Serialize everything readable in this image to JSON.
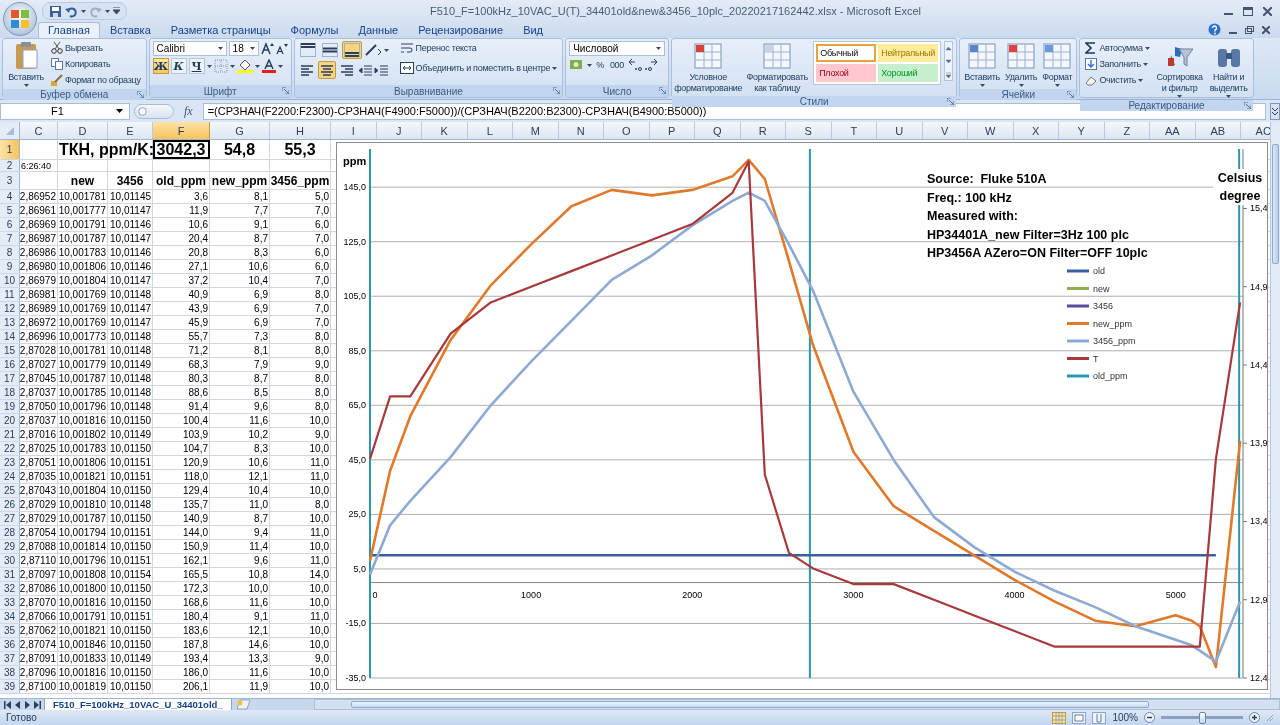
{
  "window": {
    "title": "F510_F=100kHz_10VAC_U(T)_34401old&new&3456_10plc_20220217162442.xlsx - Microsoft Excel"
  },
  "ribbon": {
    "tabs": [
      {
        "label": "Главная",
        "selected": true
      },
      {
        "label": "Вставка",
        "selected": false
      },
      {
        "label": "Разметка страницы",
        "selected": false
      },
      {
        "label": "Формулы",
        "selected": false
      },
      {
        "label": "Данные",
        "selected": false
      },
      {
        "label": "Рецензирование",
        "selected": false
      },
      {
        "label": "Вид",
        "selected": false
      }
    ],
    "groups": [
      {
        "kind": "clipboard",
        "label": "Буфер обмена",
        "paste": "Вставить",
        "items": [
          "Вырезать",
          "Копировать",
          "Формат по образцу"
        ]
      },
      {
        "kind": "font",
        "label": "Шрифт",
        "font": "Calibri",
        "size": "18",
        "styles": [
          {
            "label": "Ж",
            "on": true
          },
          {
            "label": "К",
            "on": false
          },
          {
            "label": "Ч",
            "on": false
          }
        ]
      },
      {
        "kind": "alignment",
        "label": "Выравнивание",
        "vertical": [
          {
            "on": false
          },
          {
            "on": false
          },
          {
            "on": true
          }
        ],
        "horizontal": [
          {
            "on": false
          },
          {
            "on": true
          },
          {
            "on": false
          }
        ],
        "wrap": "Перенос текста",
        "merge": "Объединить и поместить в центре"
      },
      {
        "kind": "number",
        "label": "Число",
        "format": "Числовой",
        "percent": "%",
        "thousands": "000"
      },
      {
        "kind": "styles",
        "label": "Стили",
        "buttons": [
          "Условное форматирование",
          "Форматировать как таблицу"
        ],
        "cell_styles": [
          {
            "label": "Обычный",
            "color": "#ffffff",
            "selected": true
          },
          {
            "label": "Нейтральный",
            "color": "#ffeb9c",
            "selected": false
          },
          {
            "label": "Плохой",
            "color": "#ffc7ce",
            "selected": false
          },
          {
            "label": "Хороший",
            "color": "#c6efce",
            "selected": false
          }
        ]
      },
      {
        "kind": "cells",
        "label": "Ячейки",
        "buttons": [
          "Вставить",
          "Удалить",
          "Формат"
        ]
      },
      {
        "kind": "editing",
        "label": "Редактирование",
        "items": [
          "Автосумма",
          "Заполнить",
          "Очистить"
        ],
        "buttons": [
          "Сортировка и фильтр",
          "Найти и выделить"
        ]
      }
    ]
  },
  "formula_bar": {
    "name_box": "F1",
    "fx": "fx",
    "formula": "=(СРЗНАЧ(F2200:F2300)-СРЗНАЧ(F4900:F5000))/(СРЗНАЧ(B2200:B2300)-СРЗНАЧ(B4900:B5000))"
  },
  "sheet": {
    "columns": [
      {
        "label": "C",
        "selected": false
      },
      {
        "label": "D",
        "selected": false
      },
      {
        "label": "E",
        "selected": false
      },
      {
        "label": "F",
        "selected": true
      },
      {
        "label": "G",
        "selected": false
      },
      {
        "label": "H",
        "selected": false
      },
      {
        "label": "I",
        "selected": false
      },
      {
        "label": "J",
        "selected": false
      },
      {
        "label": "K",
        "selected": false
      },
      {
        "label": "L",
        "selected": false
      },
      {
        "label": "M",
        "selected": false
      },
      {
        "label": "N",
        "selected": false
      },
      {
        "label": "O",
        "selected": false
      },
      {
        "label": "P",
        "selected": false
      },
      {
        "label": "Q",
        "selected": false
      },
      {
        "label": "R",
        "selected": false
      },
      {
        "label": "S",
        "selected": false
      },
      {
        "label": "T",
        "selected": false
      },
      {
        "label": "U",
        "selected": false
      },
      {
        "label": "V",
        "selected": false
      },
      {
        "label": "W",
        "selected": false
      },
      {
        "label": "X",
        "selected": false
      },
      {
        "label": "Y",
        "selected": false
      },
      {
        "label": "Z",
        "selected": false
      },
      {
        "label": "AA",
        "selected": false
      },
      {
        "label": "AB",
        "selected": false
      },
      {
        "label": "AC",
        "selected": false
      }
    ],
    "rows": [
      {
        "row": "1",
        "kind": "title",
        "selected": true,
        "cells": [
          null,
          "ТКН, ppm/K:",
          null,
          "3042,3",
          "54,8",
          "55,3"
        ]
      },
      {
        "row": "2",
        "kind": "time",
        "selected": false,
        "cells": [
          "6:26:40",
          null,
          null,
          null,
          null,
          null
        ]
      },
      {
        "row": "3",
        "kind": "header",
        "selected": false,
        "cells": [
          null,
          "new",
          "3456",
          "old_ppm",
          "new_ppm",
          "3456_ppm"
        ]
      },
      {
        "row": "4",
        "kind": "data",
        "selected": false,
        "cells": [
          "2,86952",
          "10,001781",
          "10,01145",
          "3,6",
          "8,1",
          "5,0"
        ]
      },
      {
        "row": "5",
        "kind": "data",
        "selected": false,
        "cells": [
          "2,86961",
          "10,001777",
          "10,01147",
          "11,9",
          "7,7",
          "7,0"
        ]
      },
      {
        "row": "6",
        "kind": "data",
        "selected": false,
        "cells": [
          "2,86969",
          "10,001791",
          "10,01146",
          "10,6",
          "9,1",
          "6,0"
        ]
      },
      {
        "row": "7",
        "kind": "data",
        "selected": false,
        "cells": [
          "2,86987",
          "10,001787",
          "10,01147",
          "20,4",
          "8,7",
          "7,0"
        ]
      },
      {
        "row": "8",
        "kind": "data",
        "selected": false,
        "cells": [
          "2,86986",
          "10,001783",
          "10,01146",
          "20,8",
          "8,3",
          "6,0"
        ]
      },
      {
        "row": "9",
        "kind": "data",
        "selected": false,
        "cells": [
          "2,86980",
          "10,001806",
          "10,01146",
          "27,1",
          "10,6",
          "6,0"
        ]
      },
      {
        "row": "10",
        "kind": "data",
        "selected": false,
        "cells": [
          "2,86979",
          "10,001804",
          "10,01147",
          "37,2",
          "10,4",
          "7,0"
        ]
      },
      {
        "row": "11",
        "kind": "data",
        "selected": false,
        "cells": [
          "2,86981",
          "10,001769",
          "10,01148",
          "40,9",
          "6,9",
          "8,0"
        ]
      },
      {
        "row": "12",
        "kind": "data",
        "selected": false,
        "cells": [
          "2,86989",
          "10,001769",
          "10,01147",
          "43,9",
          "6,9",
          "7,0"
        ]
      },
      {
        "row": "13",
        "kind": "data",
        "selected": false,
        "cells": [
          "2,86972",
          "10,001769",
          "10,01147",
          "45,9",
          "6,9",
          "7,0"
        ]
      },
      {
        "row": "14",
        "kind": "data",
        "selected": false,
        "cells": [
          "2,86996",
          "10,001773",
          "10,01148",
          "55,7",
          "7,3",
          "8,0"
        ]
      },
      {
        "row": "15",
        "kind": "data",
        "selected": false,
        "cells": [
          "2,87028",
          "10,001781",
          "10,01148",
          "71,2",
          "8,1",
          "8,0"
        ]
      },
      {
        "row": "16",
        "kind": "data",
        "selected": false,
        "cells": [
          "2,87027",
          "10,001779",
          "10,01149",
          "68,3",
          "7,9",
          "9,0"
        ]
      },
      {
        "row": "17",
        "kind": "data",
        "selected": false,
        "cells": [
          "2,87045",
          "10,001787",
          "10,01148",
          "80,3",
          "8,7",
          "8,0"
        ]
      },
      {
        "row": "18",
        "kind": "data",
        "selected": false,
        "cells": [
          "2,87037",
          "10,001785",
          "10,01148",
          "88,6",
          "8,5",
          "8,0"
        ]
      },
      {
        "row": "19",
        "kind": "data",
        "selected": false,
        "cells": [
          "2,87050",
          "10,001796",
          "10,01148",
          "91,4",
          "9,6",
          "8,0"
        ]
      },
      {
        "row": "20",
        "kind": "data",
        "selected": false,
        "cells": [
          "2,87037",
          "10,001816",
          "10,01150",
          "100,4",
          "11,6",
          "10,0"
        ]
      },
      {
        "row": "21",
        "kind": "data",
        "selected": false,
        "cells": [
          "2,87016",
          "10,001802",
          "10,01149",
          "103,9",
          "10,2",
          "9,0"
        ]
      },
      {
        "row": "22",
        "kind": "data",
        "selected": false,
        "cells": [
          "2,87025",
          "10,001783",
          "10,01150",
          "104,7",
          "8,3",
          "10,0"
        ]
      },
      {
        "row": "23",
        "kind": "data",
        "selected": false,
        "cells": [
          "2,87051",
          "10,001806",
          "10,01151",
          "120,9",
          "10,6",
          "11,0"
        ]
      },
      {
        "row": "24",
        "kind": "data",
        "selected": false,
        "cells": [
          "2,87035",
          "10,001821",
          "10,01151",
          "118,0",
          "12,1",
          "11,0"
        ]
      },
      {
        "row": "25",
        "kind": "data",
        "selected": false,
        "cells": [
          "2,87043",
          "10,001804",
          "10,01150",
          "129,4",
          "10,4",
          "10,0"
        ]
      },
      {
        "row": "26",
        "kind": "data",
        "selected": false,
        "cells": [
          "2,87029",
          "10,001810",
          "10,01148",
          "135,7",
          "11,0",
          "8,0"
        ]
      },
      {
        "row": "27",
        "kind": "data",
        "selected": false,
        "cells": [
          "2,87029",
          "10,001787",
          "10,01150",
          "140,9",
          "8,7",
          "10,0"
        ]
      },
      {
        "row": "28",
        "kind": "data",
        "selected": false,
        "cells": [
          "2,87054",
          "10,001794",
          "10,01151",
          "144,0",
          "9,4",
          "11,0"
        ]
      },
      {
        "row": "29",
        "kind": "data",
        "selected": false,
        "cells": [
          "2,87088",
          "10,001814",
          "10,01150",
          "150,9",
          "11,4",
          "10,0"
        ]
      },
      {
        "row": "30",
        "kind": "data",
        "selected": false,
        "cells": [
          "2,87110",
          "10,001796",
          "10,01151",
          "162,1",
          "9,6",
          "11,0"
        ]
      },
      {
        "row": "31",
        "kind": "data",
        "selected": false,
        "cells": [
          "2,87097",
          "10,001808",
          "10,01154",
          "165,5",
          "10,8",
          "14,0"
        ]
      },
      {
        "row": "32",
        "kind": "data",
        "selected": false,
        "cells": [
          "2,87086",
          "10,001800",
          "10,01150",
          "172,3",
          "10,0",
          "10,0"
        ]
      },
      {
        "row": "33",
        "kind": "data",
        "selected": false,
        "cells": [
          "2,87070",
          "10,001816",
          "10,01150",
          "168,6",
          "11,6",
          "10,0"
        ]
      },
      {
        "row": "34",
        "kind": "data",
        "selected": false,
        "cells": [
          "2,87066",
          "10,001791",
          "10,01151",
          "180,4",
          "9,1",
          "11,0"
        ]
      },
      {
        "row": "35",
        "kind": "data",
        "selected": false,
        "cells": [
          "2,87062",
          "10,001821",
          "10,01150",
          "183,6",
          "12,1",
          "10,0"
        ]
      },
      {
        "row": "36",
        "kind": "data",
        "selected": false,
        "cells": [
          "2,87074",
          "10,001846",
          "10,01150",
          "187,8",
          "14,6",
          "10,0"
        ]
      },
      {
        "row": "37",
        "kind": "data",
        "selected": false,
        "cells": [
          "2,87091",
          "10,001833",
          "10,01149",
          "193,4",
          "13,3",
          "9,0"
        ]
      },
      {
        "row": "38",
        "kind": "data",
        "selected": false,
        "cells": [
          "2,87096",
          "10,001816",
          "10,01150",
          "186,0",
          "11,6",
          "10,0"
        ]
      },
      {
        "row": "39",
        "kind": "data",
        "selected": false,
        "cells": [
          "2,87100",
          "10,001819",
          "10,01150",
          "206,1",
          "11,9",
          "10,0"
        ]
      }
    ]
  },
  "chart": {
    "text_box": [
      "Source:  Fluke 510A",
      "Freq.: 100 kHz",
      "Measured with:",
      "HP34401A_new Filter=3Hz 100 plc",
      "HP3456A AZero=ON Filter=OFF 10plc"
    ],
    "chart_data": {
      "type": "line",
      "ylabel": "ppm",
      "y2label": "Celsius degree",
      "x": [
        0,
        125,
        250,
        500,
        750,
        1000,
        1250,
        1500,
        1750,
        2000,
        2250,
        2350,
        2450,
        2600,
        2750,
        3000,
        3250,
        3500,
        3750,
        4000,
        4250,
        4500,
        4750,
        5000,
        5100,
        5150,
        5250,
        5400
      ],
      "grid": true,
      "legend": "right",
      "xlim": [
        0,
        5418
      ],
      "ylim": [
        -35,
        159
      ],
      "y2lim": [
        12.4,
        15.78
      ],
      "xticks": [
        0,
        1000,
        2000,
        3000,
        4000,
        5000
      ],
      "yticks": [
        {
          "value": -35,
          "label": "-35,0"
        },
        {
          "value": -15,
          "label": "-15,0"
        },
        {
          "value": 5,
          "label": "5,0"
        },
        {
          "value": 25,
          "label": "25,0"
        },
        {
          "value": 45,
          "label": "45,0"
        },
        {
          "value": 65,
          "label": "65,0"
        },
        {
          "value": 85,
          "label": "85,0"
        },
        {
          "value": 105,
          "label": "105,0"
        },
        {
          "value": 125,
          "label": "125,0"
        },
        {
          "value": 145,
          "label": "145,0"
        }
      ],
      "y2ticks": [
        {
          "value": 12.4,
          "label": "12,4"
        },
        {
          "value": 12.9,
          "label": "12,9"
        },
        {
          "value": 13.4,
          "label": "13,4"
        },
        {
          "value": 13.9,
          "label": "13,9"
        },
        {
          "value": 14.4,
          "label": "14,4"
        },
        {
          "value": 14.9,
          "label": "14,9"
        },
        {
          "value": 15.4,
          "label": "15,4"
        }
      ],
      "series": [
        {
          "name": "old",
          "color": "#3a5f9e",
          "values": [
            10,
            10,
            10,
            10,
            10,
            10,
            10,
            10,
            10,
            10,
            10,
            10,
            10,
            10,
            10,
            10,
            10,
            10,
            10,
            10,
            10,
            10,
            10,
            10,
            10,
            10,
            10,
            null
          ]
        },
        {
          "name": "new",
          "color": "#8fb04c",
          "values": [
            null,
            null,
            null,
            null,
            null,
            null,
            null,
            null,
            null,
            null,
            null,
            null,
            null,
            null,
            null,
            null,
            null,
            null,
            null,
            null,
            null,
            null,
            null,
            null,
            null,
            null,
            null,
            null
          ]
        },
        {
          "name": "3456",
          "color": "#5b4a9a",
          "values": [
            null,
            null,
            null,
            null,
            null,
            null,
            null,
            null,
            null,
            null,
            null,
            null,
            null,
            null,
            null,
            null,
            null,
            null,
            null,
            null,
            null,
            null,
            null,
            null,
            null,
            null,
            null,
            null
          ]
        },
        {
          "name": "new_ppm",
          "color": "#e0792a",
          "values": [
            8,
            41,
            61,
            89,
            109,
            124,
            138,
            144,
            142,
            144,
            149,
            155,
            148,
            118,
            87,
            48,
            28,
            19,
            10,
            1,
            -7,
            -14,
            -16,
            -12,
            -14,
            -16,
            -31,
            52
          ]
        },
        {
          "name": "3456_ppm",
          "color": "#8ea9d3",
          "values": [
            3,
            21,
            30,
            46,
            65,
            81,
            96,
            111,
            120,
            131,
            140,
            143,
            140,
            124,
            107,
            70,
            45,
            24,
            13,
            4,
            -3,
            -9,
            -16,
            -21,
            -23,
            -25,
            -29,
            -7
          ]
        },
        {
          "name": "T",
          "color": "#a8383b",
          "axis": "y2",
          "values": [
            13.8,
            14.2,
            14.2,
            14.6,
            14.8,
            14.9,
            15.0,
            15.1,
            15.2,
            15.3,
            15.5,
            15.7,
            13.7,
            13.2,
            13.1,
            13.0,
            13.0,
            12.9,
            12.8,
            12.7,
            12.6,
            12.6,
            12.6,
            12.6,
            12.6,
            12.6,
            13.8,
            14.8
          ]
        },
        {
          "name": "old_ppm",
          "color": "#2a97ad",
          "values": [
            null,
            null,
            null,
            null,
            null,
            null,
            null,
            null,
            null,
            null,
            null,
            null,
            null,
            null,
            null,
            null,
            null,
            null,
            null,
            null,
            null,
            null,
            null,
            null,
            null,
            null,
            null,
            null
          ]
        }
      ],
      "ref_lines": [
        {
          "axis": "x",
          "value": 0,
          "color": "#2a97ad"
        },
        {
          "axis": "x",
          "value": 2730,
          "color": "#2a97ad"
        },
        {
          "axis": "x",
          "value": 5394,
          "color": "#2a97ad"
        }
      ]
    }
  },
  "bottom": {
    "sheet_tabs": [
      {
        "label": "F510_F=100kHz_10VAC_U_34401old_",
        "selected": true
      }
    ],
    "status": "Готово",
    "zoom": {
      "label": "100%",
      "level": 0.5
    }
  }
}
